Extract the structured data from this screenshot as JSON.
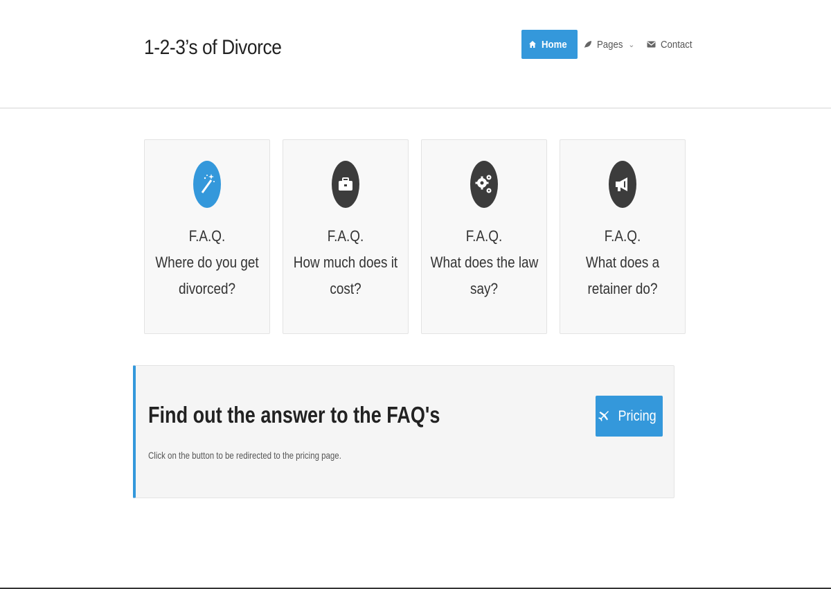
{
  "header": {
    "brand": "1-2-3’s of Divorce",
    "nav": [
      {
        "label": "Home",
        "icon": "home-icon",
        "active": true
      },
      {
        "label": "Pages",
        "icon": "leaf-icon",
        "dropdown": true
      },
      {
        "label": "Contact",
        "icon": "envelope-icon"
      }
    ]
  },
  "cards": [
    {
      "icon": "magic-wand-icon",
      "color": "#3498db",
      "line1": "F.A.Q.",
      "line2": "Where do you get",
      "line3": "divorced?"
    },
    {
      "icon": "briefcase-icon",
      "color": "#3c3c3c",
      "line1": "F.A.Q.",
      "line2": "How much does it",
      "line3": "cost?"
    },
    {
      "icon": "gears-icon",
      "color": "#3c3c3c",
      "line1": "F.A.Q.",
      "line2": "What does the law",
      "line3": "say?"
    },
    {
      "icon": "megaphone-icon",
      "color": "#3c3c3c",
      "line1": "F.A.Q.",
      "line2": "What does a",
      "line3": "retainer do?"
    }
  ],
  "cta": {
    "title": "Find out the answer to the FAQ's",
    "description": "Click on the button to be redirected to the pricing page.",
    "button_label": "Pricing",
    "button_icon": "plane-icon"
  },
  "colors": {
    "accent": "#3498db",
    "dark_icon": "#3c3c3c"
  }
}
